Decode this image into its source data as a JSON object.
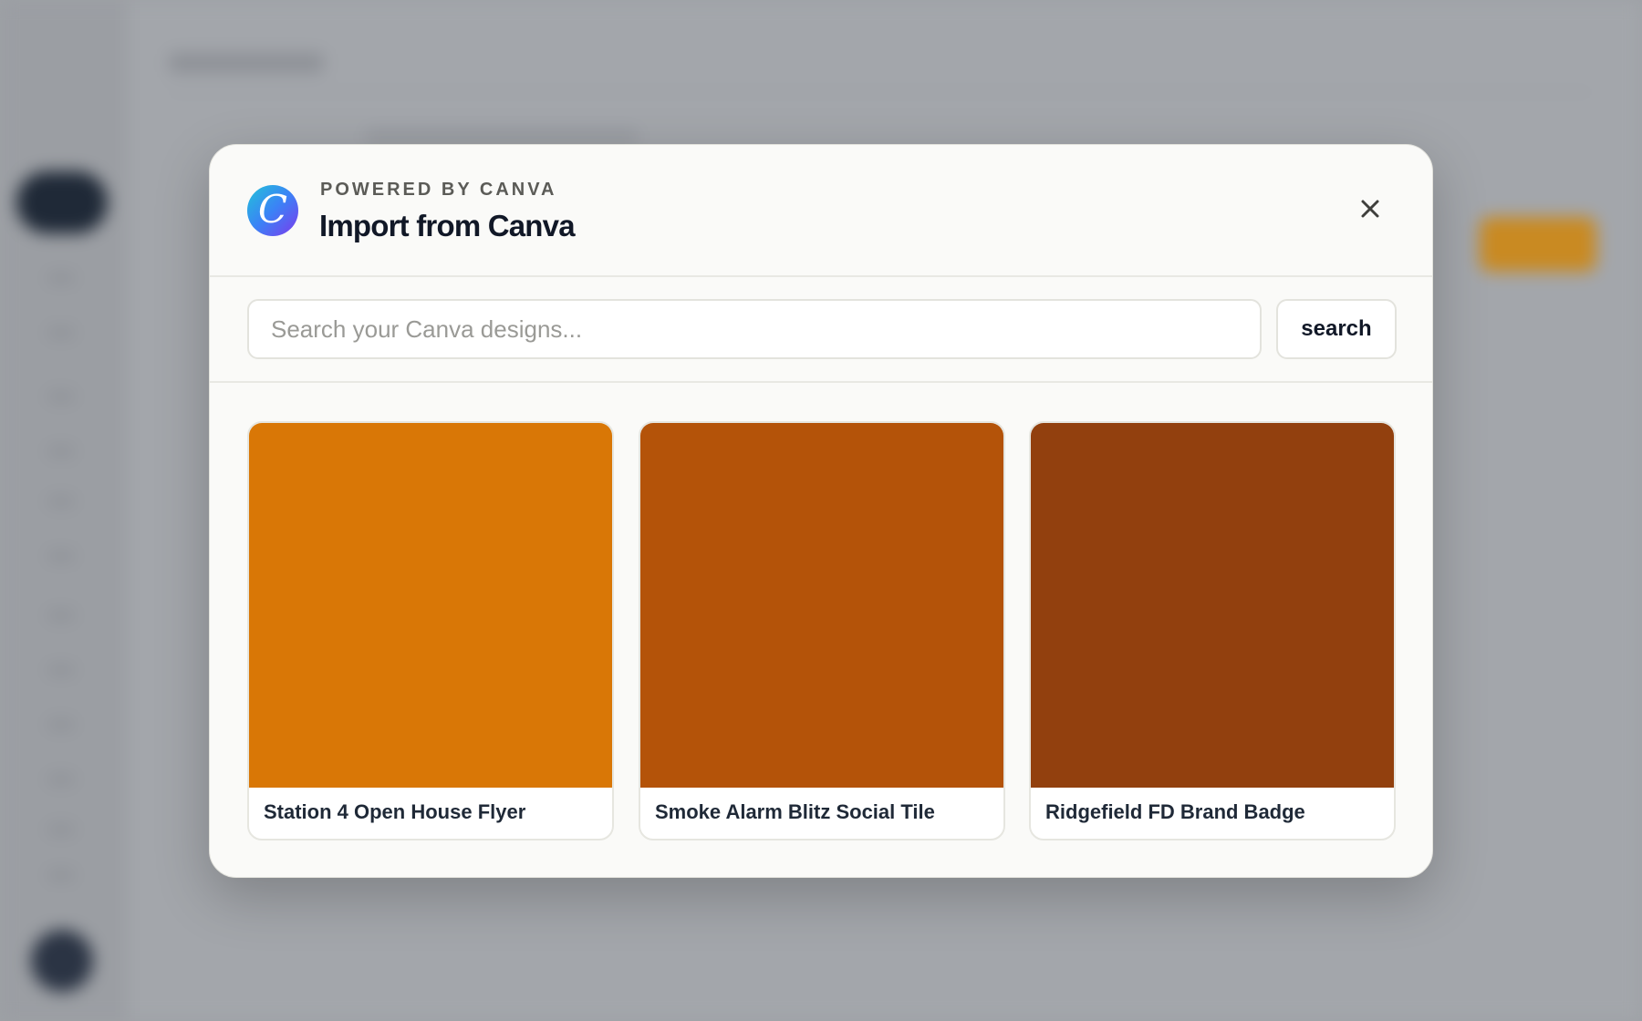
{
  "dialog": {
    "eyebrow": "POWERED BY CANVA",
    "title": "Import from Canva",
    "logo_letter": "C"
  },
  "search": {
    "placeholder": "Search your Canva designs...",
    "value": "",
    "button_label": "search"
  },
  "designs": [
    {
      "title": "Station 4 Open House Flyer",
      "color": "#d97706"
    },
    {
      "title": "Smoke Alarm Blitz Social Tile",
      "color": "#b45309"
    },
    {
      "title": "Ridgefield FD Brand Badge",
      "color": "#92400e"
    }
  ],
  "icons": {
    "logo": "canva-logo-icon",
    "close": "close-icon"
  }
}
